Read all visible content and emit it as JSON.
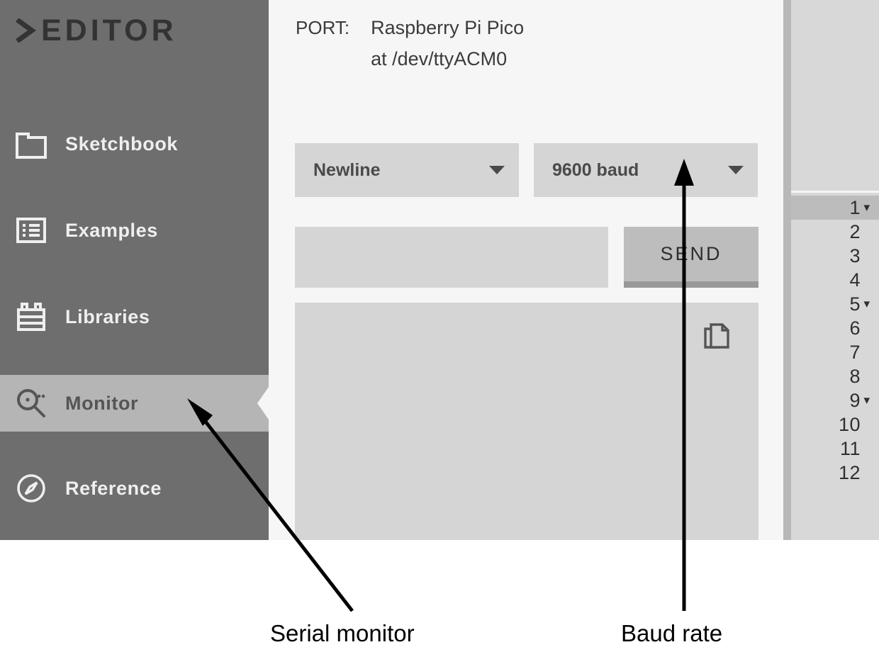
{
  "sidebar": {
    "brand": {
      "chevron_icon": "chevron-right-icon",
      "text": "EDITOR"
    },
    "items": [
      {
        "label": "Sketchbook",
        "icon": "folder-icon",
        "active": false
      },
      {
        "label": "Examples",
        "icon": "list-icon",
        "active": false
      },
      {
        "label": "Libraries",
        "icon": "crate-icon",
        "active": false
      },
      {
        "label": "Monitor",
        "icon": "search-dot-icon",
        "active": true
      },
      {
        "label": "Reference",
        "icon": "compass-icon",
        "active": false
      }
    ]
  },
  "monitor": {
    "port_label": "PORT:",
    "port_device": "Raspberry Pi Pico",
    "port_path": "at /dev/ttyACM0",
    "line_ending": {
      "selected": "Newline",
      "caret_icon": "chevron-down-icon"
    },
    "baud": {
      "selected": "9600 baud",
      "caret_icon": "chevron-down-icon"
    },
    "send_input_value": "",
    "send_input_placeholder": "",
    "send_label": "SEND",
    "copy_icon": "copy-icon",
    "console_text": ""
  },
  "editor": {
    "lines": [
      {
        "num": "1",
        "fold": "▾",
        "current": true
      },
      {
        "num": "2",
        "fold": "",
        "current": false
      },
      {
        "num": "3",
        "fold": "",
        "current": false
      },
      {
        "num": "4",
        "fold": "",
        "current": false
      },
      {
        "num": "5",
        "fold": "▾",
        "current": false
      },
      {
        "num": "6",
        "fold": "",
        "current": false
      },
      {
        "num": "7",
        "fold": "",
        "current": false
      },
      {
        "num": "8",
        "fold": "",
        "current": false
      },
      {
        "num": "9",
        "fold": "▾",
        "current": false
      },
      {
        "num": "10",
        "fold": "",
        "current": false
      },
      {
        "num": "11",
        "fold": "",
        "current": false
      },
      {
        "num": "12",
        "fold": "",
        "current": false
      }
    ]
  },
  "annotations": {
    "serial_monitor": "Serial monitor",
    "baud_rate": "Baud rate"
  },
  "colors": {
    "sidebar_bg": "#6e6e6e",
    "sidebar_active_bg": "#b5b5b5",
    "panel_bg": "#f6f6f6",
    "control_bg": "#d5d5d5",
    "button_bg": "#bdbdbd",
    "button_shadow": "#999999",
    "gutter_bg": "#d8d8d8",
    "gutter_current_bg": "#bcbcbc",
    "text_dark": "#3b3b3b",
    "text_light": "#efefef",
    "annotation": "#000000"
  }
}
